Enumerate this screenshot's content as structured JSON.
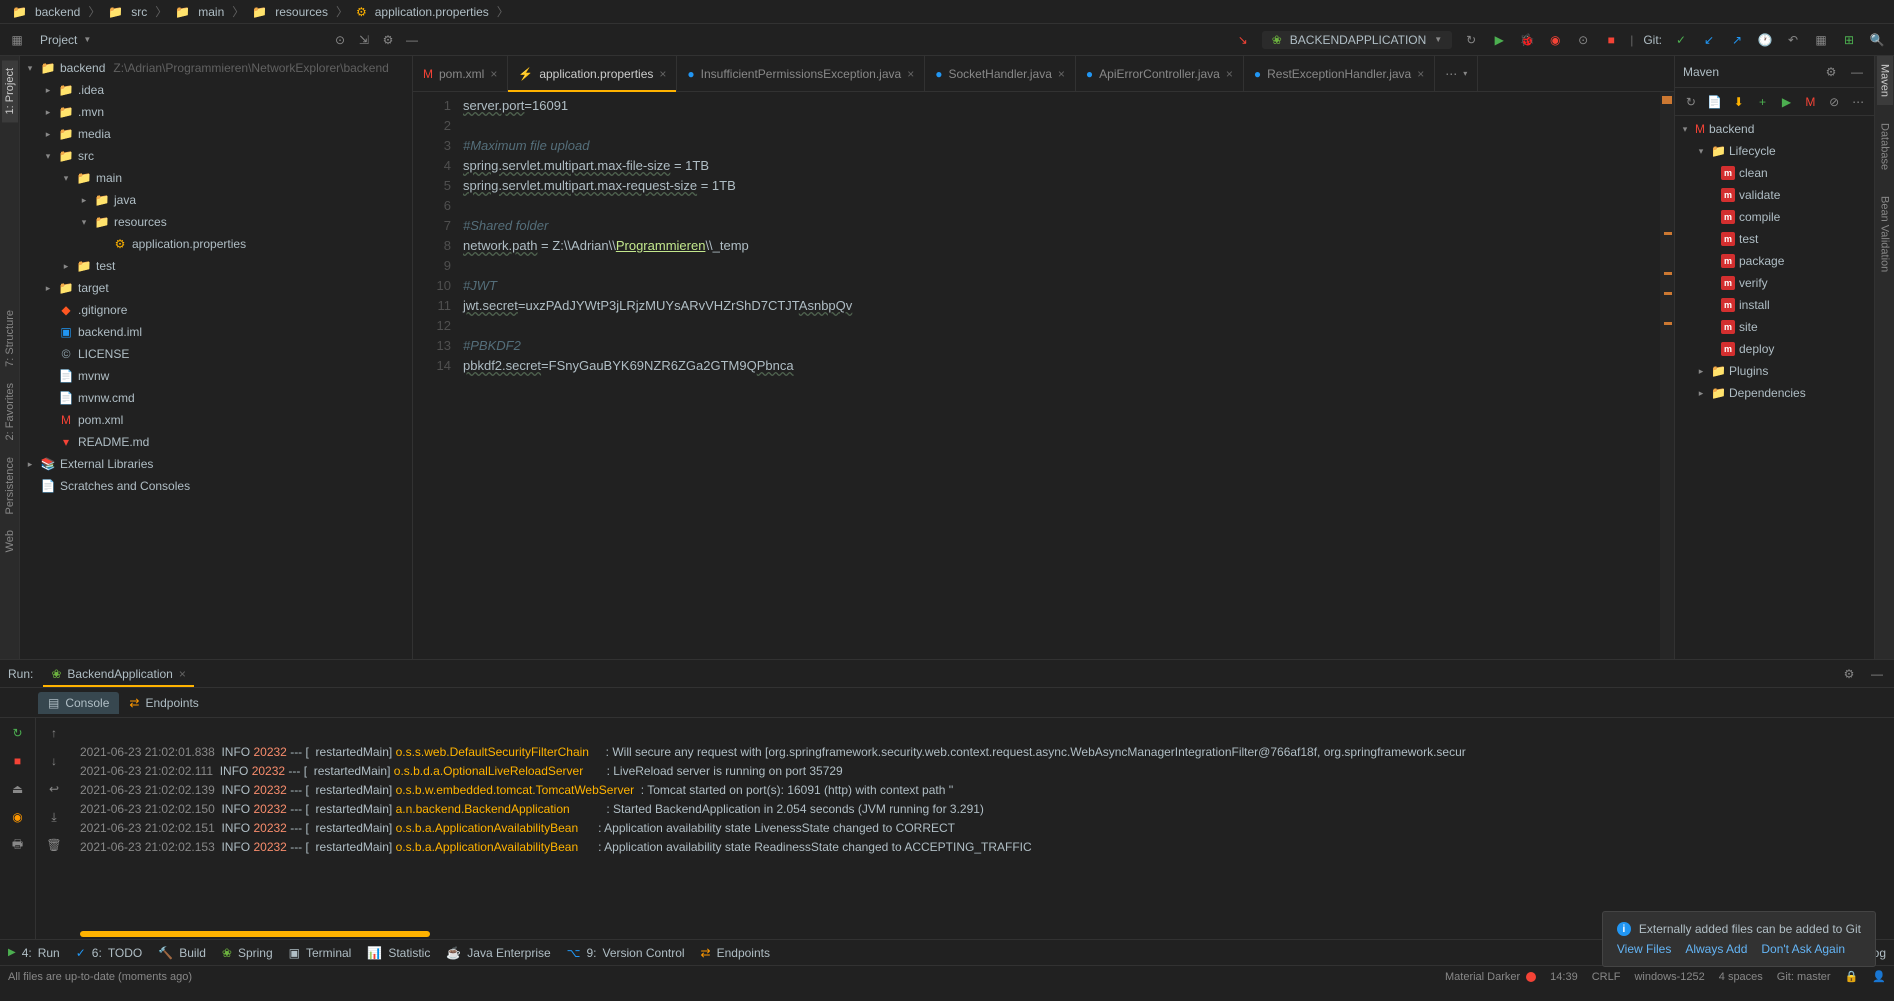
{
  "breadcrumb": [
    "backend",
    "src",
    "main",
    "resources",
    "application.properties"
  ],
  "toolbar": {
    "project_label": "Project",
    "run_config": "BACKENDAPPLICATION",
    "git_label": "Git:"
  },
  "project_tree": {
    "root": {
      "name": "backend",
      "path": "Z:\\Adrian\\Programmieren\\NetworkExplorer\\backend"
    },
    "nodes": [
      {
        "name": ".idea",
        "icon": "folder",
        "indent": 1,
        "arrow": ">"
      },
      {
        "name": ".mvn",
        "icon": "folder",
        "indent": 1,
        "arrow": ">"
      },
      {
        "name": "media",
        "icon": "folder",
        "indent": 1,
        "arrow": ">"
      },
      {
        "name": "src",
        "icon": "folder",
        "indent": 1,
        "arrow": "v"
      },
      {
        "name": "main",
        "icon": "folder",
        "indent": 2,
        "arrow": "v"
      },
      {
        "name": "java",
        "icon": "folder",
        "indent": 3,
        "arrow": ">"
      },
      {
        "name": "resources",
        "icon": "folder",
        "indent": 3,
        "arrow": "v"
      },
      {
        "name": "application.properties",
        "icon": "prop",
        "indent": 4,
        "arrow": ""
      },
      {
        "name": "test",
        "icon": "folder",
        "indent": 2,
        "arrow": ">"
      },
      {
        "name": "target",
        "icon": "red-folder",
        "indent": 1,
        "arrow": ">"
      },
      {
        "name": ".gitignore",
        "icon": "git",
        "indent": 1,
        "arrow": ""
      },
      {
        "name": "backend.iml",
        "icon": "iml",
        "indent": 1,
        "arrow": ""
      },
      {
        "name": "LICENSE",
        "icon": "lic",
        "indent": 1,
        "arrow": ""
      },
      {
        "name": "mvnw",
        "icon": "file",
        "indent": 1,
        "arrow": ""
      },
      {
        "name": "mvnw.cmd",
        "icon": "file",
        "indent": 1,
        "arrow": ""
      },
      {
        "name": "pom.xml",
        "icon": "xml",
        "indent": 1,
        "arrow": ""
      },
      {
        "name": "README.md",
        "icon": "md",
        "indent": 1,
        "arrow": ""
      }
    ],
    "extra": [
      "External Libraries",
      "Scratches and Consoles"
    ]
  },
  "tabs": [
    {
      "name": "pom.xml",
      "icon": "xml"
    },
    {
      "name": "application.properties",
      "icon": "prop",
      "active": true
    },
    {
      "name": "InsufficientPermissionsException.java",
      "icon": "java"
    },
    {
      "name": "SocketHandler.java",
      "icon": "java"
    },
    {
      "name": "ApiErrorController.java",
      "icon": "java"
    },
    {
      "name": "RestExceptionHandler.java",
      "icon": "java"
    }
  ],
  "editor": {
    "lines": [
      {
        "n": 1,
        "t": "kv",
        "k": "server.port",
        "v": "16091"
      },
      {
        "n": 2,
        "t": "blank"
      },
      {
        "n": 3,
        "t": "comment",
        "c": "#Maximum file upload"
      },
      {
        "n": 4,
        "t": "kv",
        "k": "spring.servlet.multipart.max-file-size",
        "sp": " = ",
        "v": "1TB"
      },
      {
        "n": 5,
        "t": "kv",
        "k": "spring.servlet.multipart.max-request-size",
        "sp": " = ",
        "v": "1TB"
      },
      {
        "n": 6,
        "t": "blank"
      },
      {
        "n": 7,
        "t": "comment",
        "c": "#Shared folder"
      },
      {
        "n": 8,
        "t": "path",
        "k": "network.path",
        "sp": " = ",
        "pre": "Z:\\\\Adrian\\\\",
        "link": "Programmieren",
        "post": "\\\\_temp"
      },
      {
        "n": 9,
        "t": "blank"
      },
      {
        "n": 10,
        "t": "comment",
        "c": "#JWT"
      },
      {
        "n": 11,
        "t": "kvm",
        "k": "jwt.secret",
        "v1": "uxzPAdJYWtP3jLRjzMUYsARvVHZrShD7CTJT",
        "v2": "AsnbpQv"
      },
      {
        "n": 12,
        "t": "blank"
      },
      {
        "n": 13,
        "t": "comment",
        "c": "#PBKDF2"
      },
      {
        "n": 14,
        "t": "kvm",
        "k": "pbkdf2.secret",
        "v1": "FSnyGauBYK69NZR6ZGa2GTM9Q",
        "v2": "Pbnca"
      }
    ]
  },
  "maven": {
    "title": "Maven",
    "root": "backend",
    "lifecycle": "Lifecycle",
    "goals": [
      "clean",
      "validate",
      "compile",
      "test",
      "package",
      "verify",
      "install",
      "site",
      "deploy"
    ],
    "plugins": "Plugins",
    "dependencies": "Dependencies"
  },
  "run": {
    "label": "Run:",
    "tab": "BackendApplication",
    "console": "Console",
    "endpoints": "Endpoints",
    "logs": [
      {
        "ts": "2021-06-23 21:02:01.838",
        "lvl": "INFO",
        "pid": "20232",
        "thr": "restartedMain",
        "cls": "o.s.s.web.DefaultSecurityFilterChain",
        "msg": "Will secure any request with [org.springframework.security.web.context.request.async.WebAsyncManagerIntegrationFilter@766af18f, org.springframework.secur"
      },
      {
        "ts": "2021-06-23 21:02:02.111",
        "lvl": "INFO",
        "pid": "20232",
        "thr": "restartedMain",
        "cls": "o.s.b.d.a.OptionalLiveReloadServer",
        "msg": "LiveReload server is running on port 35729"
      },
      {
        "ts": "2021-06-23 21:02:02.139",
        "lvl": "INFO",
        "pid": "20232",
        "thr": "restartedMain",
        "cls": "o.s.b.w.embedded.tomcat.TomcatWebServer",
        "msg": "Tomcat started on port(s): 16091 (http) with context path ''"
      },
      {
        "ts": "2021-06-23 21:02:02.150",
        "lvl": "INFO",
        "pid": "20232",
        "thr": "restartedMain",
        "cls": "a.n.backend.BackendApplication",
        "msg": "Started BackendApplication in 2.054 seconds (JVM running for 3.291)"
      },
      {
        "ts": "2021-06-23 21:02:02.151",
        "lvl": "INFO",
        "pid": "20232",
        "thr": "restartedMain",
        "cls": "o.s.b.a.ApplicationAvailabilityBean",
        "msg": "Application availability state LivenessState changed to CORRECT"
      },
      {
        "ts": "2021-06-23 21:02:02.153",
        "lvl": "INFO",
        "pid": "20232",
        "thr": "restartedMain",
        "cls": "o.s.b.a.ApplicationAvailabilityBean",
        "msg": "Application availability state ReadinessState changed to ACCEPTING_TRAFFIC"
      }
    ]
  },
  "notification": {
    "text": "Externally added files can be added to Git",
    "links": [
      "View Files",
      "Always Add",
      "Don't Ask Again"
    ]
  },
  "bottom_tools": [
    "Run",
    "TODO",
    "Build",
    "Spring",
    "Terminal",
    "Statistic",
    "Java Enterprise",
    "Version Control",
    "Endpoints"
  ],
  "event_log": "Event Log",
  "status": {
    "left": "All files are up-to-date (moments ago)",
    "theme": "Material Darker",
    "time": "14:39",
    "crlf": "CRLF",
    "enc": "windows-1252",
    "spaces": "4 spaces",
    "git": "Git: master"
  },
  "side_tabs": {
    "left": [
      "1: Project",
      "7: Structure",
      "2: Favorites",
      "Persistence",
      "Web"
    ],
    "right": [
      "Maven",
      "Database",
      "Bean Validation"
    ]
  }
}
